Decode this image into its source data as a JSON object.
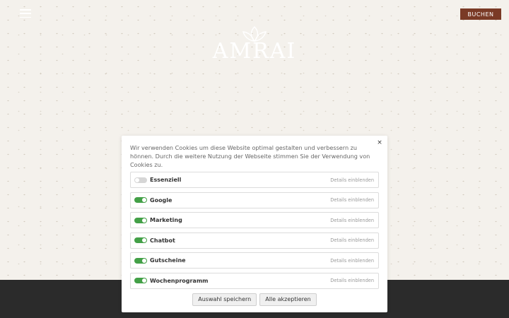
{
  "header": {
    "menu_icon": "hamburger-icon",
    "book_label": "BUCHEN",
    "brand_color": "#7a3a26"
  },
  "logo": {
    "text": "AMRAI",
    "icon": "lotus-leaf-icon"
  },
  "cookie_banner": {
    "close_label": "×",
    "intro": "Wir verwenden Cookies um diese Website optimal gestalten und verbessern zu hönnen. Durch die weitere Nutzung der Webseite stimmen Sie der Verwendung von Cookies zu.",
    "toggle_on_color": "#43a047",
    "categories": [
      {
        "label": "Essenziell",
        "enabled": false,
        "disabled": true,
        "details": "Details einblenden"
      },
      {
        "label": "Google",
        "enabled": true,
        "disabled": false,
        "details": "Details einblenden"
      },
      {
        "label": "Marketing",
        "enabled": true,
        "disabled": false,
        "details": "Details einblenden"
      },
      {
        "label": "Chatbot",
        "enabled": true,
        "disabled": false,
        "details": "Details einblenden"
      },
      {
        "label": "Gutscheine",
        "enabled": true,
        "disabled": false,
        "details": "Details einblenden"
      },
      {
        "label": "Wochenprogramm",
        "enabled": true,
        "disabled": false,
        "details": "Details einblenden"
      }
    ],
    "save_label": "Auswahl speichern",
    "accept_all_label": "Alle akzeptieren"
  }
}
